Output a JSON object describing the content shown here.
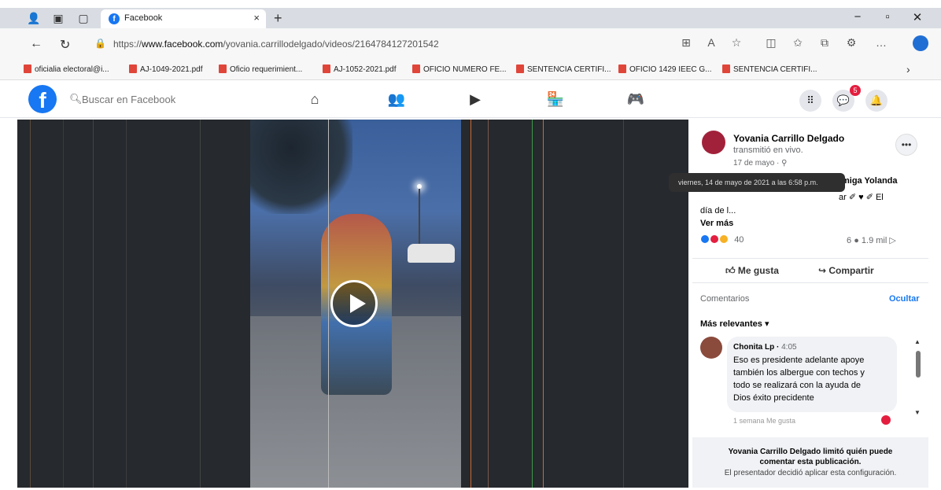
{
  "browser": {
    "tab_title": "Facebook",
    "tab_close": "×",
    "new_tab": "+",
    "url_prefix": "https://",
    "url_domain": "www.facebook.com",
    "url_path": "/yovania.carrillodelgado/videos/2164784127201542",
    "window_controls": {
      "minimize": "−",
      "restore": "▫",
      "close": "✕"
    }
  },
  "bookmarks": [
    "oficialia electoral@i...",
    "AJ-1049-2021.pdf",
    "Oficio requerimient...",
    "AJ-1052-2021.pdf",
    "OFICIO NUMERO FE...",
    "SENTENCIA CERTIFI...",
    "OFICIO 1429 IEEC G...",
    "SENTENCIA CERTIFI..."
  ],
  "facebook": {
    "logo": "f",
    "search_placeholder": "Buscar en Facebook",
    "notifications_badge": "5"
  },
  "post": {
    "author": "Yovania Carrillo Delgado",
    "subtitle": "transmitió en vivo.",
    "date": "17 de mayo · ⚲",
    "tooltip": "viernes, 14 de mayo de 2021 a las 6:58 p.m.",
    "desc_fragment": "miga Yolanda",
    "desc_fragment2": "ar ✐ ♥ ✐ El",
    "desc_line3": "día de l...",
    "see_more": "Ver más",
    "reaction_count": "40",
    "comment_count": "6",
    "view_count": "1.9 mil",
    "like_label": "Me gusta",
    "share_label": "Compartir"
  },
  "comments": {
    "header": "Comentarios",
    "hide_label": "Ocultar",
    "sort_label": "Más relevantes",
    "items": [
      {
        "author": "Chonita Lp",
        "time": "4:05",
        "text": "Eso es presidente adelante apoye también los albergue con techos y todo se realizará con la ayuda de Dios éxito precidente",
        "actions": "1 semana   Me gusta"
      }
    ],
    "restriction_bold": "Yovania Carrillo Delgado limitó quién puede comentar esta publicación.",
    "restriction_note": "El presentador decidió aplicar esta configuración."
  },
  "colors": {
    "facebook_blue": "#1877f2",
    "video_bg": "#26292d",
    "notification_red": "#e41e3f"
  }
}
